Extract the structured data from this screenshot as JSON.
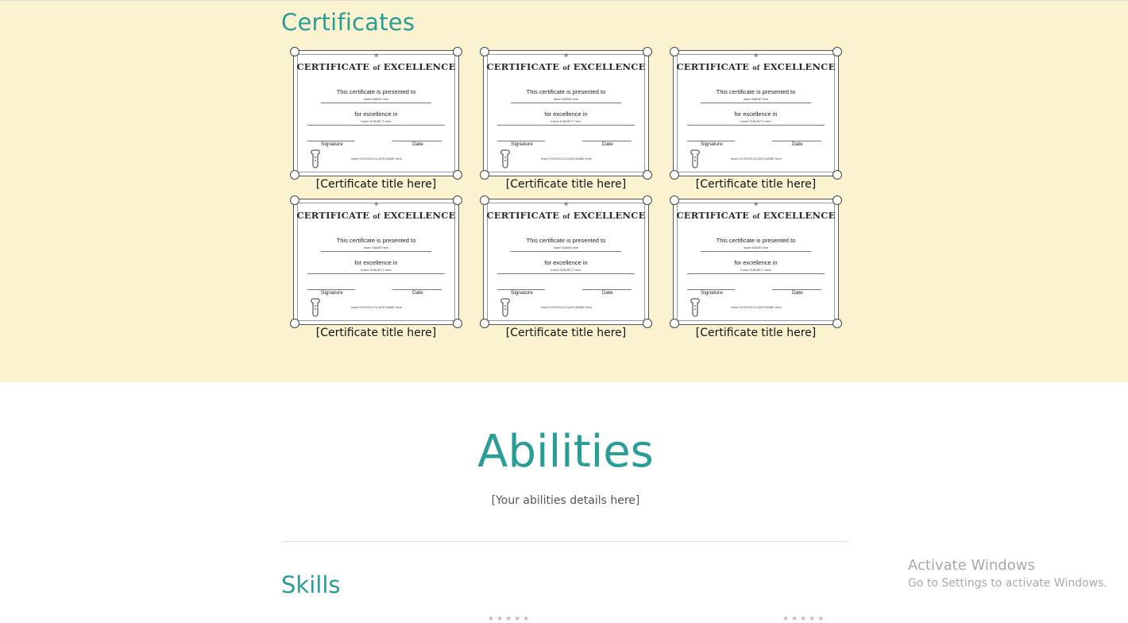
{
  "certificates": {
    "heading": "Certificates",
    "items": [
      {
        "caption": "[Certificate title here]"
      },
      {
        "caption": "[Certificate title here]"
      },
      {
        "caption": "[Certificate title here]"
      },
      {
        "caption": "[Certificate title here]"
      },
      {
        "caption": "[Certificate title here]"
      },
      {
        "caption": "[Certificate title here]"
      }
    ],
    "template": {
      "heading_part1": "CERTIFICATE",
      "heading_of": "of",
      "heading_part2": "EXCELLENCE",
      "presented": "This certificate is presented to",
      "name_hint": "Insert NAME here",
      "excellence": "for excellence in",
      "subject_hint": "Insert SUBJECT here",
      "signature": "Signature",
      "date": "Date",
      "school_hint": "Insert SCHOOL/CLASS NAME here"
    }
  },
  "abilities": {
    "heading": "Abilities",
    "details": "[Your abilities details here]"
  },
  "skills": {
    "heading": "Skills"
  },
  "watermark": {
    "title": "Activate Windows",
    "subtitle": "Go to Settings to activate Windows."
  },
  "colors": {
    "accent": "#2a9d97",
    "section_bg": "#fbf3cf"
  }
}
